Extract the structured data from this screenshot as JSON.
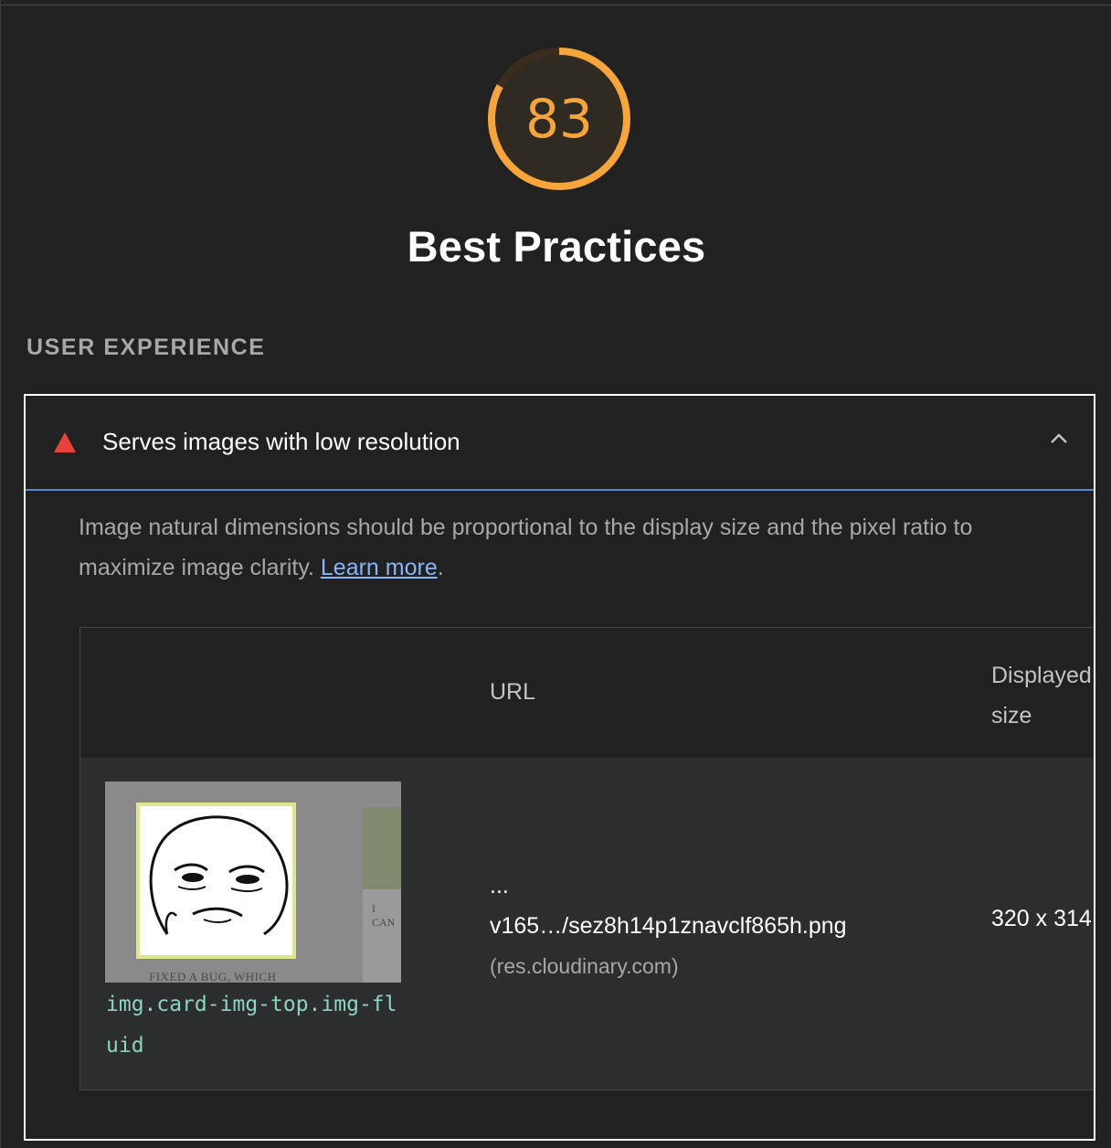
{
  "gauge": {
    "score": "83",
    "score_fraction": 0.83,
    "color": "#f5a53a",
    "track_color": "#3b2d1d"
  },
  "category": {
    "title": "Best Practices"
  },
  "group": {
    "title": "USER EXPERIENCE"
  },
  "audit": {
    "status_icon": "fail-triangle-icon",
    "status_color": "#e8423a",
    "title": "Serves images with low resolution",
    "expanded": true,
    "description": "Image natural dimensions should be proportional to the display size and the pixel ratio to maximize image clarity.",
    "learn_more": "Learn more",
    "description_end": ".",
    "table": {
      "headers": {
        "url": "URL",
        "displayed_size": "Displayed size"
      },
      "rows": [
        {
          "thumbnail_caption": "FIXED A BUG, WHICH",
          "thumbnail_side_text": "I CAN",
          "selector": "img.card-img-top.img-fluid",
          "url_ellipsis": "...",
          "url_path": "v165…/sez8h14p1znavclf865h.png",
          "url_host": "(res.cloudinary.com)",
          "displayed_size": "320 x 314"
        }
      ]
    }
  }
}
